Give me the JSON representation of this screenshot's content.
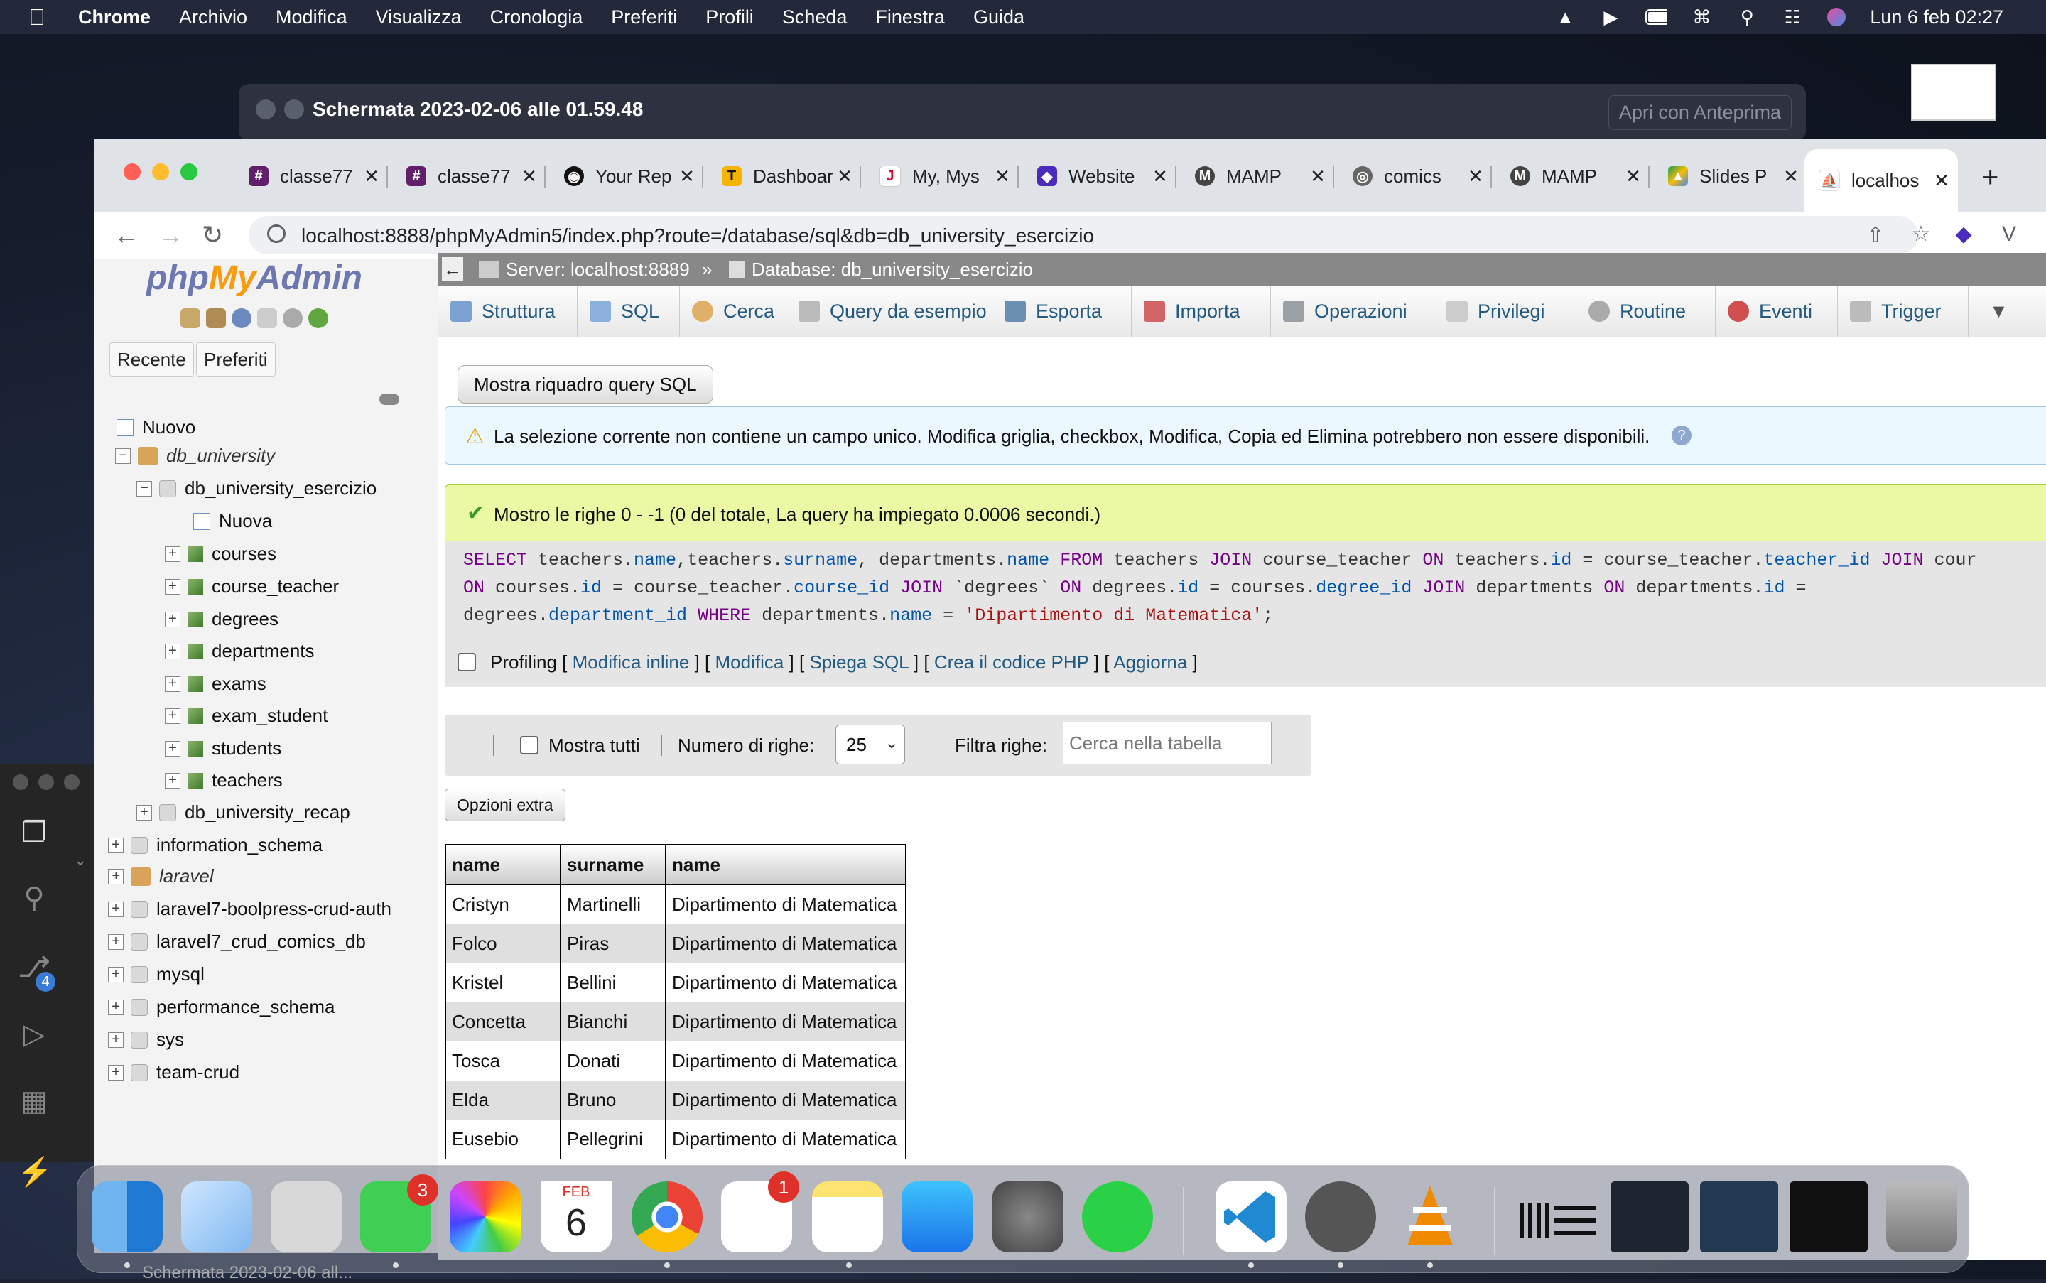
{
  "menubar": {
    "app": "Chrome",
    "items": [
      "Archivio",
      "Modifica",
      "Visualizza",
      "Cronologia",
      "Preferiti",
      "Profili",
      "Scheda",
      "Finestra",
      "Guida"
    ],
    "clock": "Lun 6 feb  02:27"
  },
  "preview": {
    "title": "Schermata 2023-02-06 alle 01.59.48",
    "open_button": "Apri con Anteprima"
  },
  "chrome": {
    "tabs": [
      {
        "title": "classe77",
        "icon": "slack-icon"
      },
      {
        "title": "classe77",
        "icon": "slack-icon"
      },
      {
        "title": "Your Rep",
        "icon": "github-icon"
      },
      {
        "title": "Dashboar",
        "icon": "trello-icon"
      },
      {
        "title": "My, Mys",
        "icon": "jira-icon"
      },
      {
        "title": "Website",
        "icon": "website-icon"
      },
      {
        "title": "MAMP",
        "icon": "mamp-icon"
      },
      {
        "title": "comics",
        "icon": "globe-icon"
      },
      {
        "title": "MAMP",
        "icon": "mamp-icon"
      },
      {
        "title": "Slides P",
        "icon": "drive-icon"
      },
      {
        "title": "localhos",
        "icon": "pma-icon"
      }
    ],
    "url": "localhost:8888/phpMyAdmin5/index.php?route=/database/sql&db=db_university_esercizio"
  },
  "pma_left": {
    "logo": {
      "php": "php",
      "my": "My",
      "admin": "Admin"
    },
    "tabs": [
      "Recente",
      "Preferiti"
    ],
    "tree": {
      "new": "Nuovo",
      "db_university": "db_university",
      "db_university_esercizio": "db_university_esercizio",
      "new_table": "Nuova",
      "tables": [
        "courses",
        "course_teacher",
        "degrees",
        "departments",
        "exams",
        "exam_student",
        "students",
        "teachers"
      ],
      "db_university_recap": "db_university_recap",
      "dbs": [
        "information_schema",
        "laravel",
        "laravel7-boolpress-crud-auth",
        "laravel7_crud_comics_db",
        "mysql",
        "performance_schema",
        "sys",
        "team-crud"
      ]
    }
  },
  "breadcrumb": {
    "server": "Server: localhost:8889",
    "sep": "»",
    "database": "Database: db_university_esercizio"
  },
  "pma_tabs": [
    "Struttura",
    "SQL",
    "Cerca",
    "Query da esempio",
    "Esporta",
    "Importa",
    "Operazioni",
    "Privilegi",
    "Routine",
    "Eventi",
    "Trigger"
  ],
  "main": {
    "show_query_button": "Mostra riquadro query SQL",
    "notice": "La selezione corrente non contiene un campo unico. Modifica griglia, checkbox, Modifica, Copia ed Elimina potrebbero non essere disponibili.",
    "success": "Mostro le righe 0 - -1 (0 del totale, La query ha impiegato 0.0006 secondi.)",
    "sql_lines": [
      "SELECT teachers.name,teachers.surname, departments.name FROM teachers JOIN course_teacher ON teachers.id = course_teacher.teacher_id JOIN cour",
      "ON courses.id = course_teacher.course_id JOIN `degrees` ON degrees.id = courses.degree_id JOIN departments ON departments.id =",
      "degrees.department_id WHERE departments.name = 'Dipartimento di Matematica';"
    ],
    "profiling": {
      "label": "Profiling",
      "links": [
        "Modifica inline",
        "Modifica",
        "Spiega SQL",
        "Crea il codice PHP",
        "Aggiorna"
      ]
    },
    "nav": {
      "show_all": "Mostra tutti",
      "rows_label": "Numero di righe:",
      "rows_value": "25",
      "filter_label": "Filtra righe:",
      "filter_placeholder": "Cerca nella tabella"
    },
    "extra_options": "Opzioni extra",
    "table": {
      "headers": [
        "name",
        "surname",
        "name"
      ],
      "rows": [
        [
          "Cristyn",
          "Martinelli",
          "Dipartimento di Matematica"
        ],
        [
          "Folco",
          "Piras",
          "Dipartimento di Matematica"
        ],
        [
          "Kristel",
          "Bellini",
          "Dipartimento di Matematica"
        ],
        [
          "Concetta",
          "Bianchi",
          "Dipartimento di Matematica"
        ],
        [
          "Tosca",
          "Donati",
          "Dipartimento di Matematica"
        ],
        [
          "Elda",
          "Bruno",
          "Dipartimento di Matematica"
        ],
        [
          "Eusebio",
          "Pellegrini",
          "Dipartimento di Matematica"
        ]
      ]
    }
  },
  "vscode": {
    "scm_badge": "4"
  },
  "dock": {
    "messages_badge": "3",
    "reminders_badge": "1",
    "calendar_month": "FEB",
    "calendar_day": "6",
    "bottom_text": "Schermata 2023-02-06 all..."
  },
  "colors": {
    "pma_link": "#235a81",
    "notice_bg": "#ebf8ff",
    "success_bg": "#ebf8a4",
    "logo_orange": "#f89c0e",
    "logo_blue": "#6c78af"
  }
}
